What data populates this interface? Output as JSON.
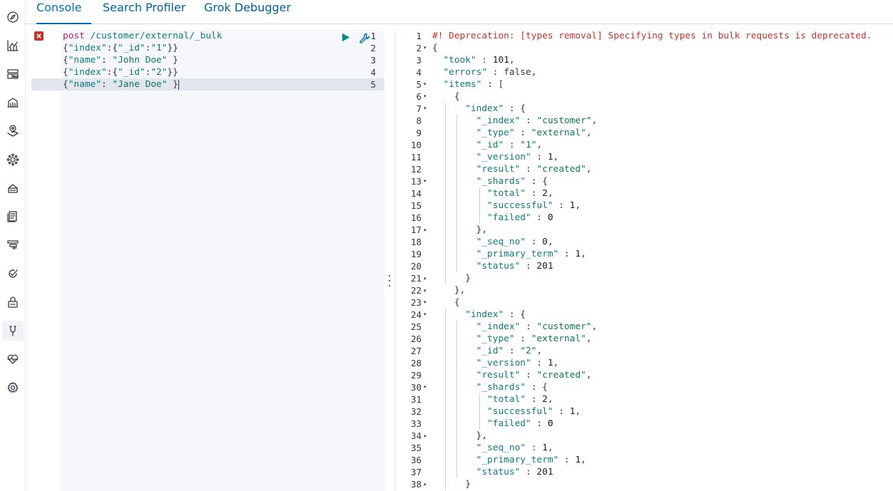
{
  "tabs": [
    {
      "label": "Console",
      "active": true
    },
    {
      "label": "Search Profiler",
      "active": false
    },
    {
      "label": "Grok Debugger",
      "active": false
    }
  ],
  "nav_icons": [
    "compass-icon",
    "chart-icon",
    "dashboard-icon",
    "canvas-icon",
    "maps-icon",
    "ml-icon",
    "infra-icon",
    "logs-icon",
    "apm-icon",
    "uptime-icon",
    "siem-icon",
    "devtools-icon",
    "monitoring-icon",
    "management-icon"
  ],
  "request": {
    "lines": [
      {
        "num": "1",
        "method": "post",
        "path": " /customer/external/_bulk"
      },
      {
        "num": "2",
        "text": "{\"index\":{\"_id\":\"1\"}}"
      },
      {
        "num": "3",
        "text": "{\"name\": \"John Doe\" }"
      },
      {
        "num": "4",
        "text": "{\"index\":{\"_id\":\"2\"}}"
      },
      {
        "num": "5",
        "text": "{\"name\": \"Jane Doe\" }"
      }
    ]
  },
  "response": {
    "lines": [
      {
        "num": "1",
        "text": "#! Deprecation: [types removal] Specifying types in bulk requests is deprecated."
      },
      {
        "num": "2",
        "text": "{",
        "fold": "down"
      },
      {
        "num": "3",
        "text": "  \"took\" : 101,"
      },
      {
        "num": "4",
        "text": "  \"errors\" : false,"
      },
      {
        "num": "5",
        "text": "  \"items\" : [",
        "fold": "down"
      },
      {
        "num": "6",
        "text": "    {",
        "fold": "down"
      },
      {
        "num": "7",
        "text": "      \"index\" : {",
        "fold": "down"
      },
      {
        "num": "8",
        "text": "        \"_index\" : \"customer\","
      },
      {
        "num": "9",
        "text": "        \"_type\" : \"external\","
      },
      {
        "num": "10",
        "text": "        \"_id\" : \"1\","
      },
      {
        "num": "11",
        "text": "        \"_version\" : 1,"
      },
      {
        "num": "12",
        "text": "        \"result\" : \"created\","
      },
      {
        "num": "13",
        "text": "        \"_shards\" : {",
        "fold": "down"
      },
      {
        "num": "14",
        "text": "          \"total\" : 2,"
      },
      {
        "num": "15",
        "text": "          \"successful\" : 1,"
      },
      {
        "num": "16",
        "text": "          \"failed\" : 0"
      },
      {
        "num": "17",
        "text": "        },",
        "fold": "up"
      },
      {
        "num": "18",
        "text": "        \"_seq_no\" : 0,"
      },
      {
        "num": "19",
        "text": "        \"_primary_term\" : 1,"
      },
      {
        "num": "20",
        "text": "        \"status\" : 201"
      },
      {
        "num": "21",
        "text": "      }",
        "fold": "up"
      },
      {
        "num": "22",
        "text": "    },",
        "fold": "up"
      },
      {
        "num": "23",
        "text": "    {",
        "fold": "down"
      },
      {
        "num": "24",
        "text": "      \"index\" : {",
        "fold": "down"
      },
      {
        "num": "25",
        "text": "        \"_index\" : \"customer\","
      },
      {
        "num": "26",
        "text": "        \"_type\" : \"external\","
      },
      {
        "num": "27",
        "text": "        \"_id\" : \"2\","
      },
      {
        "num": "28",
        "text": "        \"_version\" : 1,"
      },
      {
        "num": "29",
        "text": "        \"result\" : \"created\","
      },
      {
        "num": "30",
        "text": "        \"_shards\" : {",
        "fold": "down"
      },
      {
        "num": "31",
        "text": "          \"total\" : 2,"
      },
      {
        "num": "32",
        "text": "          \"successful\" : 1,"
      },
      {
        "num": "33",
        "text": "          \"failed\" : 0"
      },
      {
        "num": "34",
        "text": "        },",
        "fold": "up"
      },
      {
        "num": "35",
        "text": "        \"_seq_no\" : 1,"
      },
      {
        "num": "36",
        "text": "        \"_primary_term\" : 1,"
      },
      {
        "num": "37",
        "text": "        \"status\" : 201"
      },
      {
        "num": "38",
        "text": "      }",
        "fold": "up"
      }
    ]
  }
}
